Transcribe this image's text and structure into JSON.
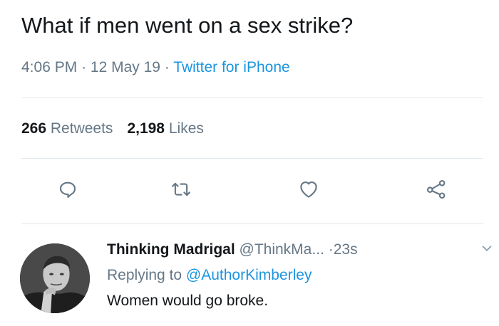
{
  "tweet": {
    "text": "What if men went on a sex strike?",
    "time": "4:06 PM",
    "date": "12 May 19",
    "separator": "·",
    "source": "Twitter for iPhone"
  },
  "stats": {
    "retweets_count": "266",
    "retweets_label": "Retweets",
    "likes_count": "2,198",
    "likes_label": "Likes"
  },
  "actions": [
    {
      "icon": "reply-icon"
    },
    {
      "icon": "retweet-icon"
    },
    {
      "icon": "heart-icon"
    },
    {
      "icon": "share-icon"
    }
  ],
  "reply": {
    "name": "Thinking Madrigal",
    "handle": "@ThinkMa...",
    "time_sep": "·",
    "time": "23s",
    "replying_prefix": "Replying to",
    "replying_to": "@AuthorKimberley",
    "text": "Women would go broke."
  },
  "colors": {
    "text": "#14171a",
    "secondary": "#657786",
    "link": "#1b95e0",
    "divider": "#e1e8ed"
  }
}
